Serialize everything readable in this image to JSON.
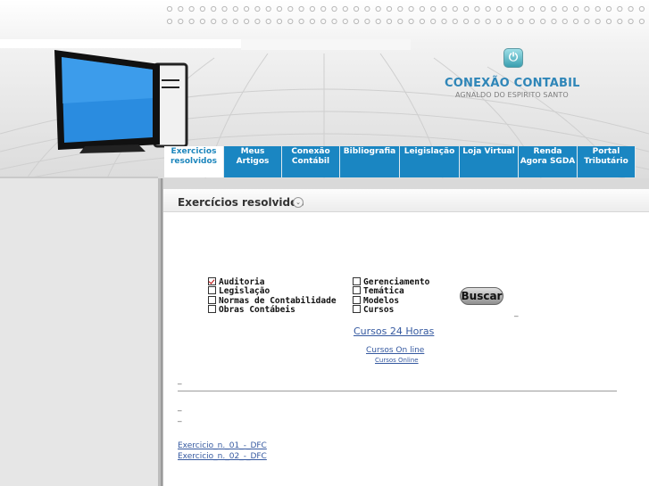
{
  "site": {
    "title": "CONEXÃO CONTABIL",
    "subtitle": "AGNALDO DO ESPIRITO SANTO"
  },
  "nav": {
    "tabs": [
      {
        "label": "Exercicios resolvidos",
        "active": true
      },
      {
        "label": "Meus Artigos",
        "active": false
      },
      {
        "label": "Conexão Contábil",
        "active": false
      },
      {
        "label": "Bibliografia",
        "active": false
      },
      {
        "label": "Leigislação",
        "active": false
      },
      {
        "label": "Loja Virtual",
        "active": false
      },
      {
        "label": "Renda Agora SGDA",
        "active": false
      },
      {
        "label": "Portal Tributário",
        "active": false
      }
    ]
  },
  "section": {
    "title": "Exercícios resolvidos"
  },
  "search": {
    "categories_left": [
      {
        "label": "Auditoria",
        "checked": true
      },
      {
        "label": "Legislação",
        "checked": false
      },
      {
        "label": "Normas de Contabilidade",
        "checked": false
      },
      {
        "label": "Obras Contábeis",
        "checked": false
      }
    ],
    "categories_right": [
      {
        "label": "Gerenciamento",
        "checked": false
      },
      {
        "label": "Temática",
        "checked": false
      },
      {
        "label": "Modelos",
        "checked": false
      },
      {
        "label": "Cursos",
        "checked": false
      }
    ],
    "button_label": "Buscar",
    "trailing_dash": "_"
  },
  "links": {
    "cursos_24": "Cursos 24 Horas",
    "cursos_online": "Cursos On line",
    "cursos_online_small": "Cursos Online"
  },
  "separators": {
    "dash1": "_",
    "dash2": "_",
    "dash3": "_"
  },
  "files": [
    "Exercicio_n._01_-_DFC",
    "Exercicio_n._02_-_DFC"
  ],
  "colors": {
    "nav_blue": "#1a86c2",
    "title_blue": "#2f86b8"
  },
  "icons": [
    "power-icon",
    "monitor-icon",
    "chevron-down-icon"
  ]
}
